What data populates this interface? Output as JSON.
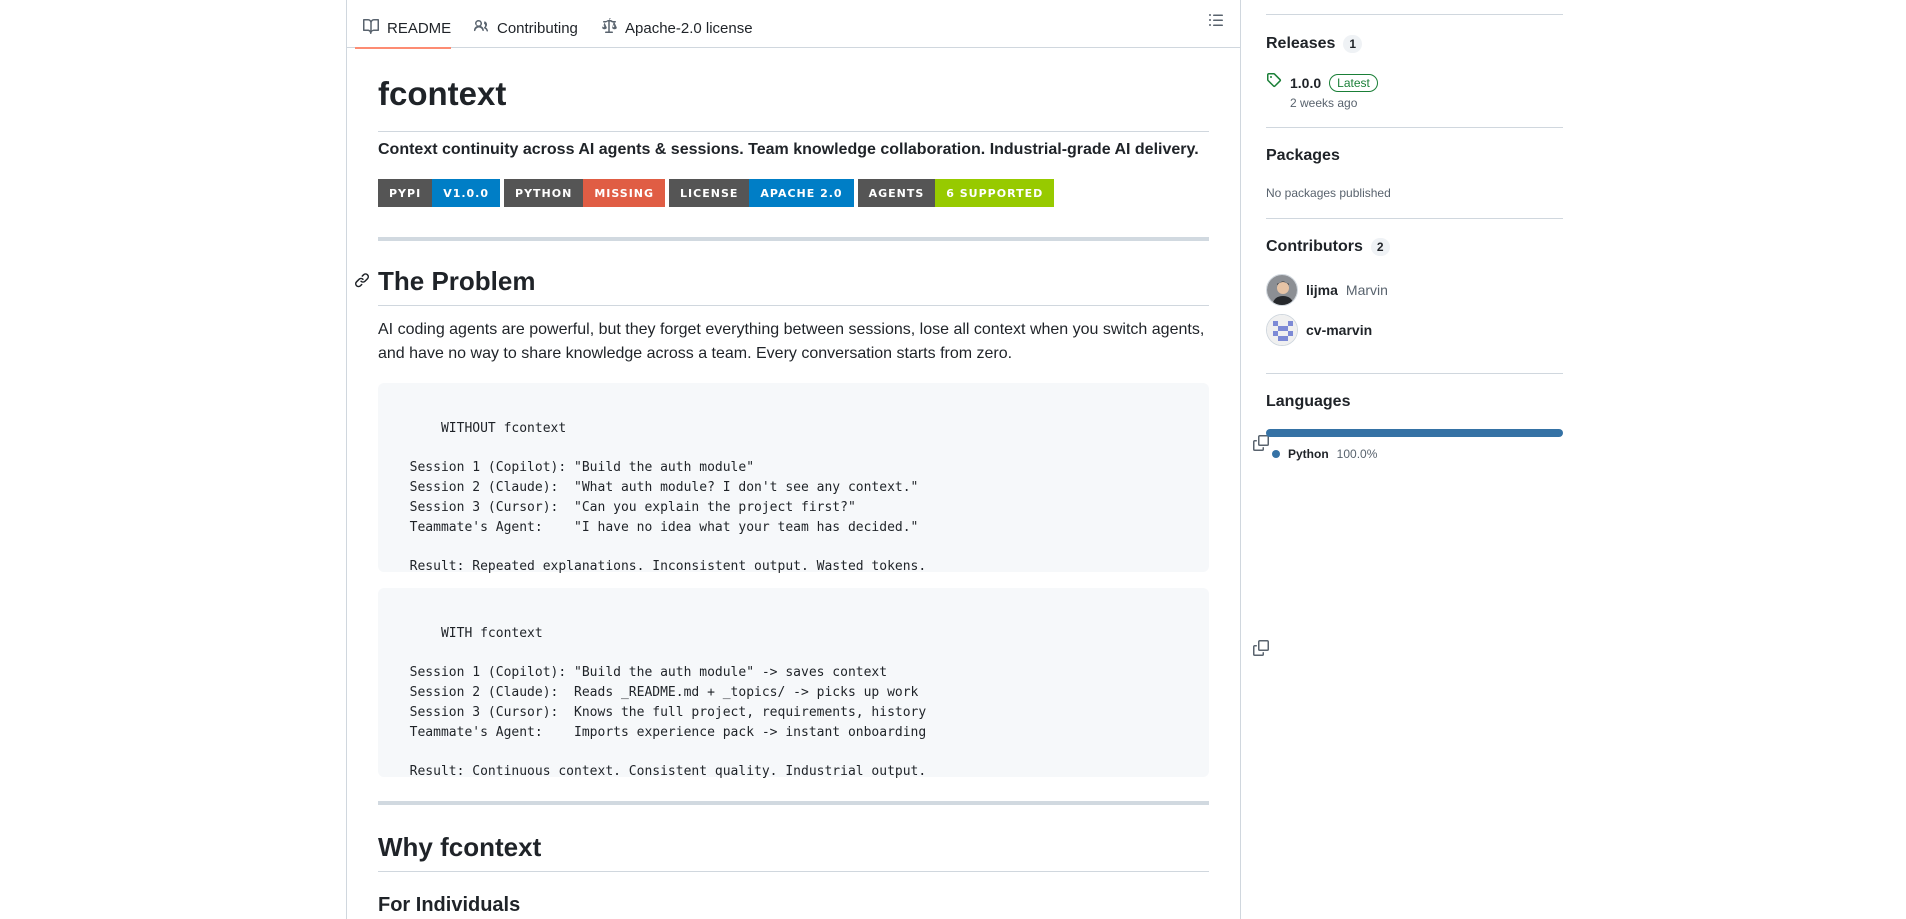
{
  "tabs": [
    {
      "label": "README",
      "icon": "book-icon"
    },
    {
      "label": "Contributing",
      "icon": "people-icon"
    },
    {
      "label": "Apache-2.0 license",
      "icon": "law-icon"
    }
  ],
  "readme": {
    "title": "fcontext",
    "tagline": "Context continuity across AI agents & sessions. Team knowledge collaboration. Industrial-grade AI delivery.",
    "badges": [
      {
        "label": "PYPI",
        "value": "V1.0.0",
        "color": "#007ec6"
      },
      {
        "label": "PYTHON",
        "value": "MISSING",
        "color": "#e05d44"
      },
      {
        "label": "LICENSE",
        "value": "APACHE 2.0",
        "color": "#007ec6"
      },
      {
        "label": "AGENTS",
        "value": "6 SUPPORTED",
        "color": "#97ca00"
      }
    ],
    "problem_heading": "The Problem",
    "problem_text": "AI coding agents are powerful, but they forget everything between sessions, lose all context when you switch agents, and have no way to share knowledge across a team. Every conversation starts from zero.",
    "code_without": "WITHOUT fcontext\n\n  Session 1 (Copilot): \"Build the auth module\"\n  Session 2 (Claude):  \"What auth module? I don't see any context.\"\n  Session 3 (Cursor):  \"Can you explain the project first?\"\n  Teammate's Agent:    \"I have no idea what your team has decided.\"\n\n  Result: Repeated explanations. Inconsistent output. Wasted tokens.",
    "code_with": "WITH fcontext\n\n  Session 1 (Copilot): \"Build the auth module\" -> saves context\n  Session 2 (Claude):  Reads _README.md + _topics/ -> picks up work\n  Session 3 (Cursor):  Knows the full project, requirements, history\n  Teammate's Agent:    Imports experience pack -> instant onboarding\n\n  Result: Continuous context. Consistent quality. Industrial output.",
    "why_heading": "Why fcontext",
    "individuals_heading": "For Individuals"
  },
  "sidebar": {
    "releases": {
      "heading": "Releases",
      "count": "1",
      "version": "1.0.0",
      "latest": "Latest",
      "time": "2 weeks ago"
    },
    "packages": {
      "heading": "Packages",
      "text": "No packages published"
    },
    "contributors": {
      "heading": "Contributors",
      "count": "2",
      "people": [
        {
          "login": "lijma",
          "name": "Marvin"
        },
        {
          "login": "cv-marvin",
          "name": ""
        }
      ]
    },
    "languages": {
      "heading": "Languages",
      "items": [
        {
          "name": "Python",
          "percent": "100.0%",
          "color": "#3572a5",
          "fraction": 1.0
        }
      ]
    }
  }
}
